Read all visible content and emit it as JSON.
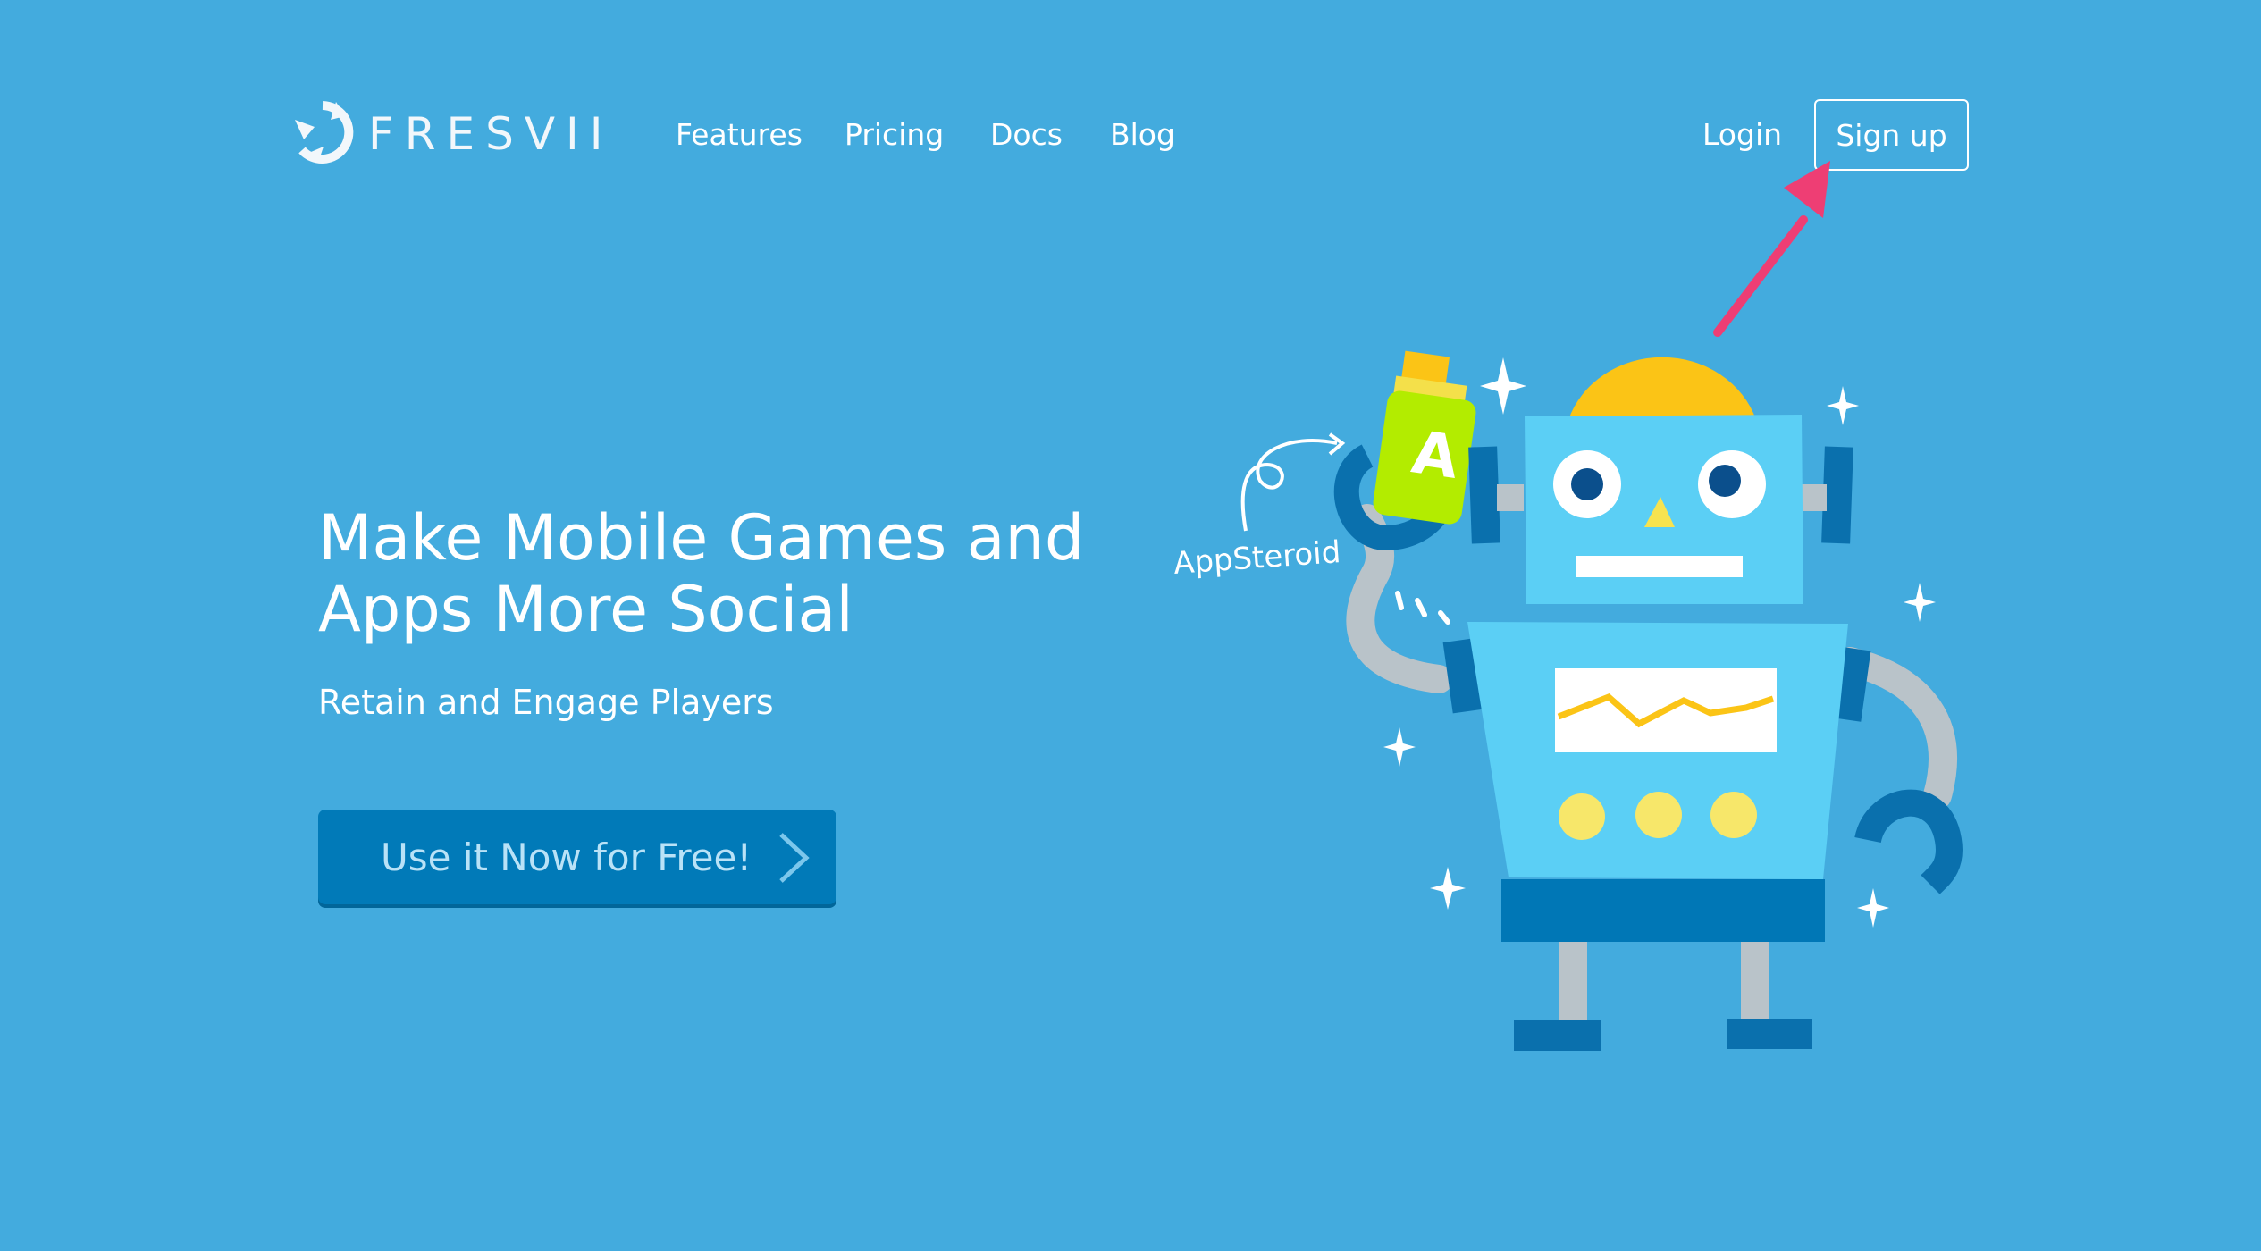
{
  "brand": {
    "name": "FRESVII",
    "logo_icon": "fresvii-logo-icon"
  },
  "nav": {
    "links": [
      "Features",
      "Pricing",
      "Docs",
      "Blog"
    ],
    "login": "Login",
    "signup": "Sign up"
  },
  "hero": {
    "title_line1": "Make Mobile Games and",
    "title_line2": "Apps More Social",
    "subtitle": "Retain and Engage Players",
    "cta_label": "Use it Now for Free!",
    "cta_icon": "chevron-right-icon"
  },
  "illustration": {
    "label": "AppSteroid",
    "bottle_letter": "A"
  },
  "colors": {
    "background": "#43abde",
    "cta": "#017ab8",
    "annotation_arrow": "#ee3e74",
    "robot_body": "#5bcff5",
    "robot_dark": "#0077b6",
    "robot_hat": "#fbc416",
    "bottle": "#b3ec00"
  }
}
